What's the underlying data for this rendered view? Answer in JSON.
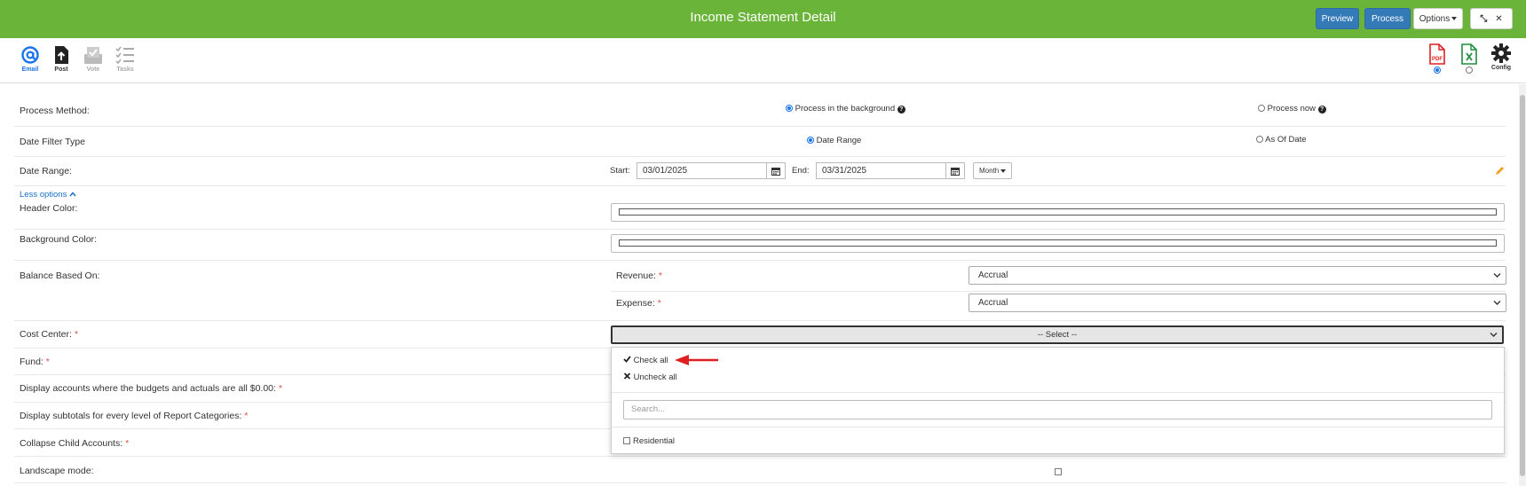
{
  "window": {
    "title": "Income Statement Detail",
    "preview_label": "Preview",
    "process_label": "Process",
    "options_label": "Options",
    "minimize_glyph": "⤡",
    "close_glyph": "✕"
  },
  "toolbar": {
    "email_label": "Email",
    "post_label": "Post",
    "vote_label": "Vote",
    "tasks_label": "Tasks",
    "config_label": "Config",
    "pdf_label": "PDF",
    "export_selected": "pdf"
  },
  "form": {
    "process_method": {
      "label": "Process Method:",
      "options": [
        "Process in the background",
        "Process now"
      ],
      "selected": "Process in the background"
    },
    "date_filter_type": {
      "label": "Date Filter Type",
      "options": [
        "Date Range",
        "As Of Date"
      ],
      "selected": "Date Range"
    },
    "date_range": {
      "label": "Date Range:",
      "start_label": "Start:",
      "start_value": "03/01/2025",
      "end_label": "End:",
      "end_value": "03/31/2025",
      "period_label": "Month"
    },
    "less_options_label": "Less options",
    "header_color_label": "Header Color:",
    "background_color_label": "Background Color:",
    "balance_based_on": {
      "label": "Balance Based On:",
      "revenue_label": "Revenue:",
      "revenue_value": "Accrual",
      "expense_label": "Expense:",
      "expense_value": "Accrual"
    },
    "cost_center": {
      "label": "Cost Center:",
      "select_value": "-- Select --"
    },
    "fund_label": "Fund:",
    "display_zero_label": "Display accounts where the budgets and actuals are all $0.00:",
    "display_subtotals_label": "Display subtotals for every level of Report Categories:",
    "collapse_child_label": "Collapse Child Accounts:",
    "landscape_label": "Landscape mode:",
    "required_mark": "*"
  },
  "dropdown": {
    "check_all_label": "Check all",
    "uncheck_all_label": "Uncheck all",
    "search_placeholder": "Search...",
    "items": [
      "Residential"
    ]
  },
  "colors": {
    "header_green": "#6ab43a",
    "primary_blue": "#337ab7",
    "required_red": "#d9534f",
    "annotation_arrow": "#e02020"
  }
}
